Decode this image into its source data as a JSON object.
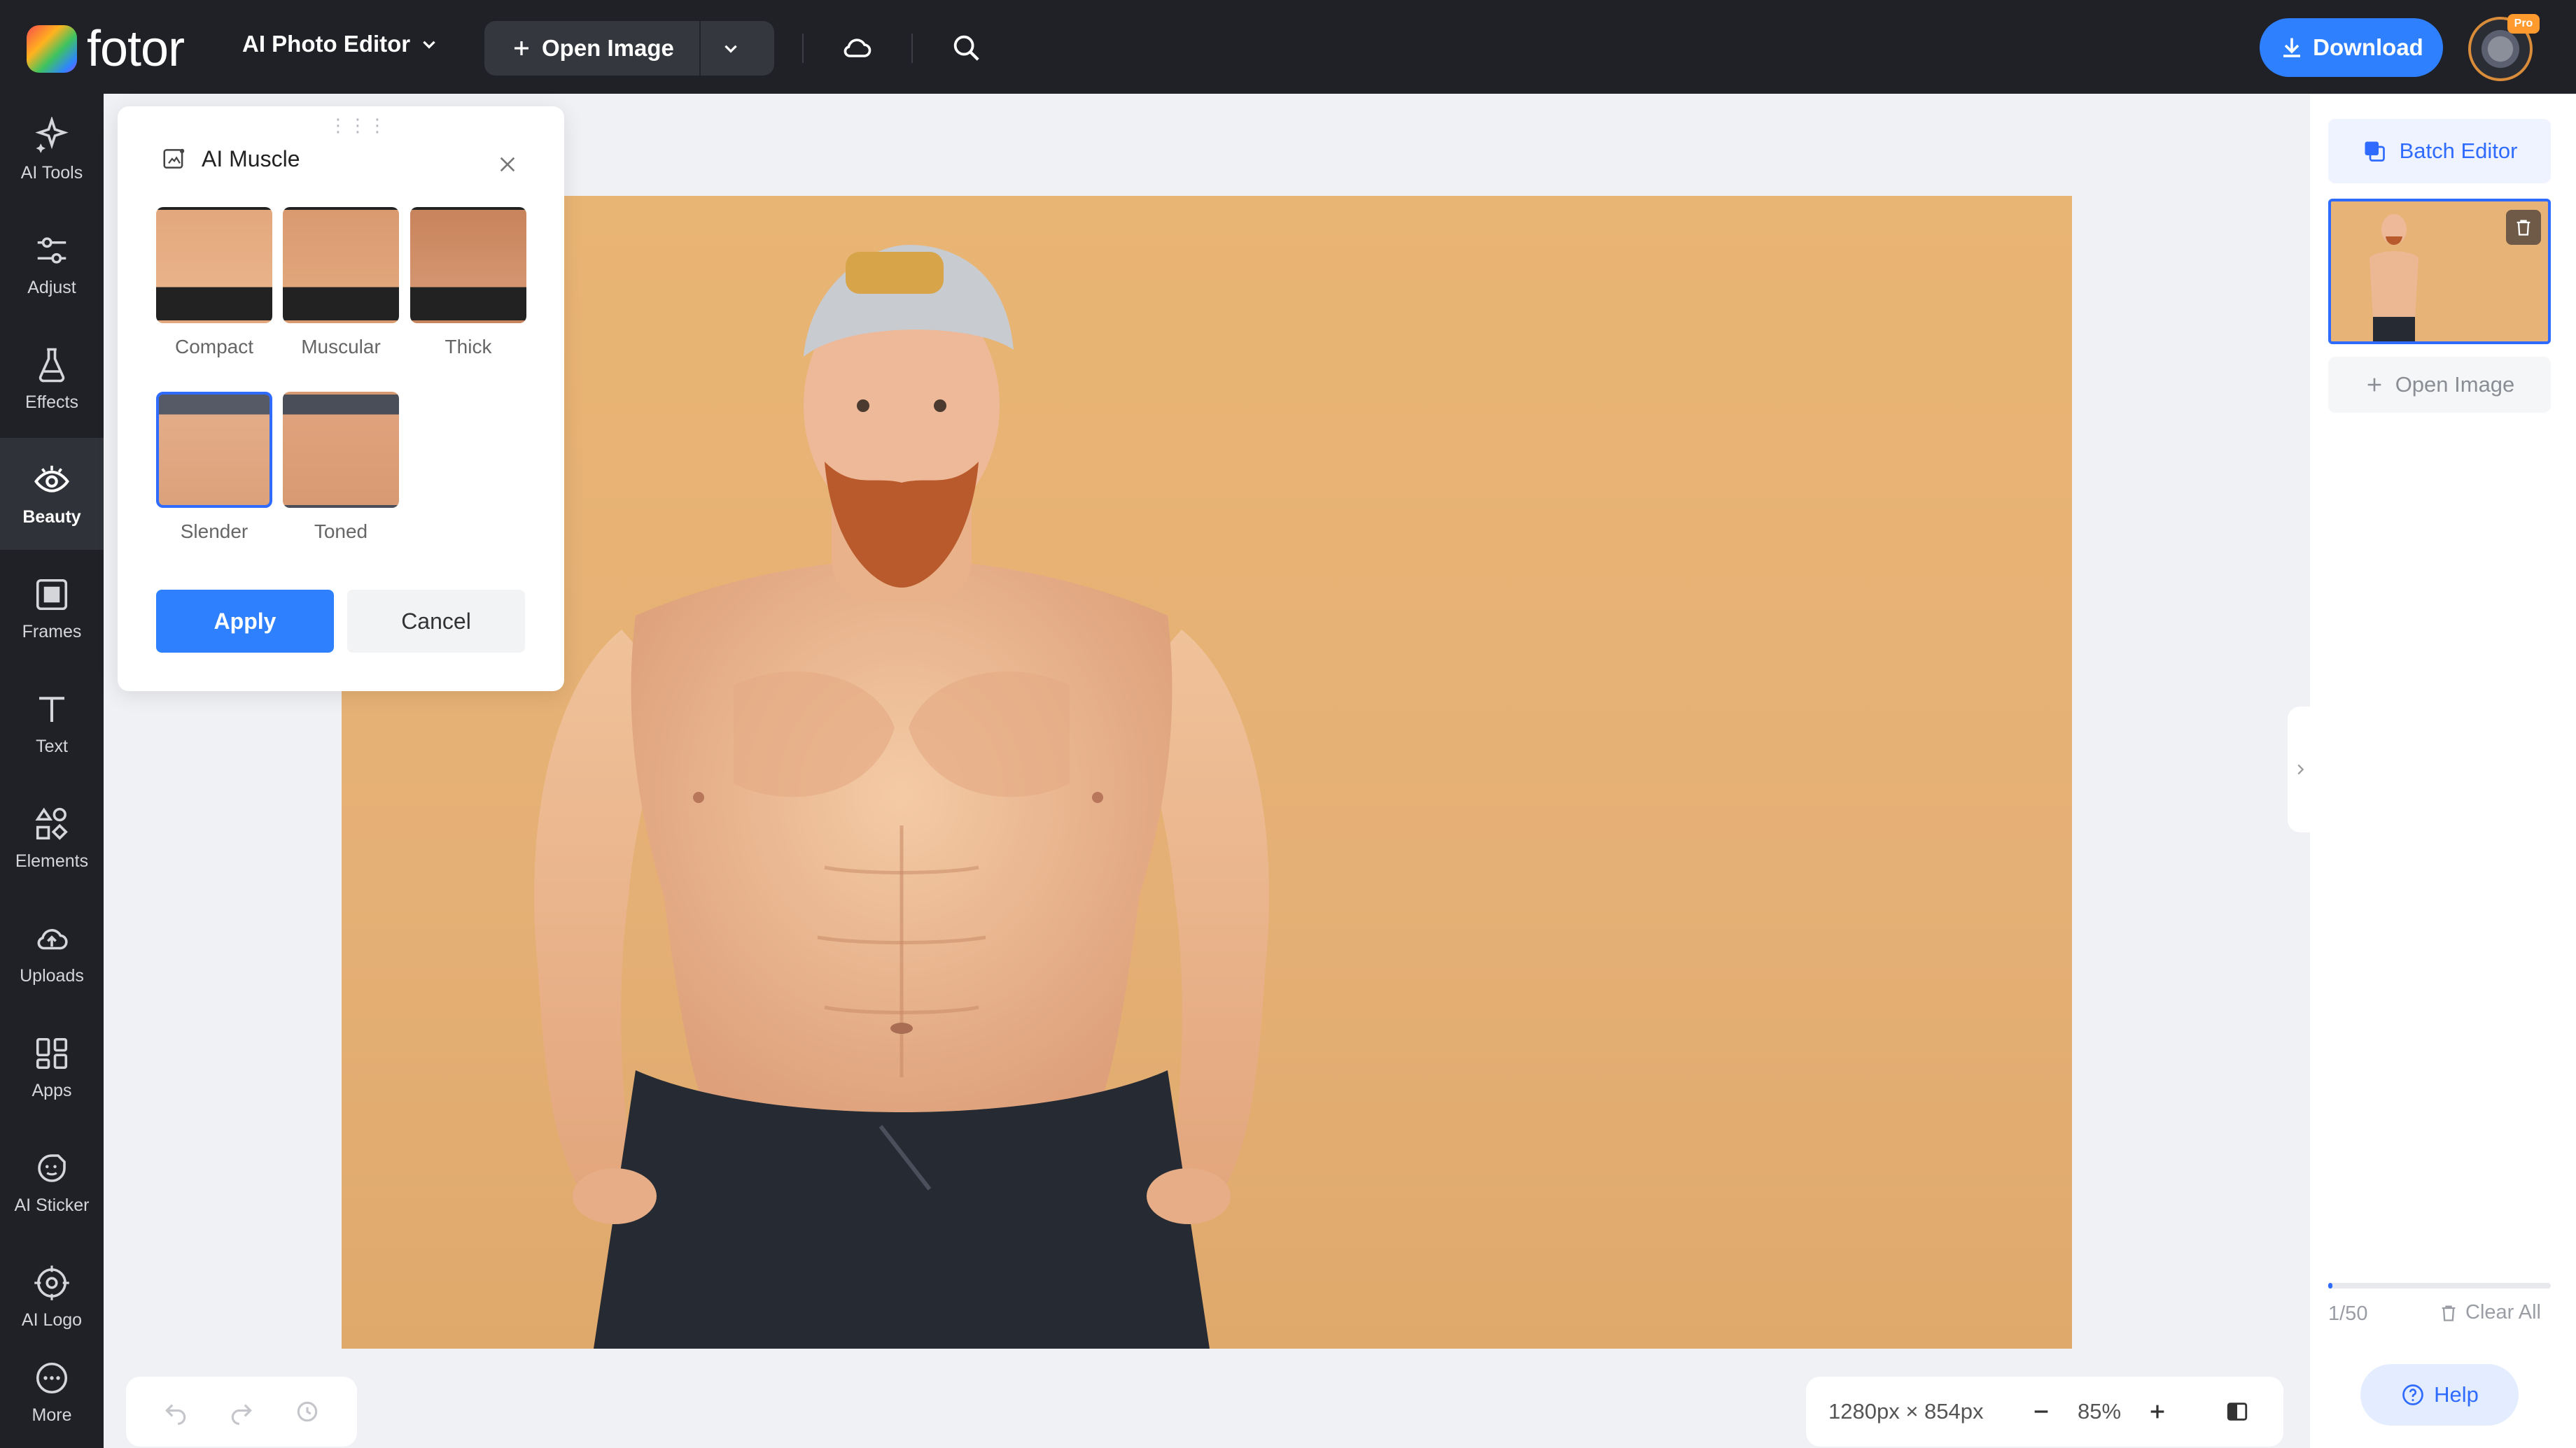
{
  "header": {
    "logo_text": "fotor",
    "app_menu_label": "AI Photo Editor",
    "open_image_label": "Open Image",
    "download_label": "Download",
    "pro_badge": "Pro"
  },
  "sidebar": {
    "items": [
      {
        "label": "AI Tools",
        "icon": "sparkle-icon"
      },
      {
        "label": "Adjust",
        "icon": "sliders-icon"
      },
      {
        "label": "Effects",
        "icon": "flask-icon"
      },
      {
        "label": "Beauty",
        "icon": "eye-icon",
        "active": true
      },
      {
        "label": "Frames",
        "icon": "frame-icon"
      },
      {
        "label": "Text",
        "icon": "text-icon"
      },
      {
        "label": "Elements",
        "icon": "shapes-icon"
      },
      {
        "label": "Uploads",
        "icon": "cloud-upload-icon"
      },
      {
        "label": "Apps",
        "icon": "apps-icon"
      },
      {
        "label": "AI Sticker",
        "icon": "sticker-icon"
      },
      {
        "label": "AI Logo",
        "icon": "ai-logo-icon"
      },
      {
        "label": "More",
        "icon": "more-icon"
      }
    ]
  },
  "panel": {
    "title": "AI Muscle",
    "options": [
      {
        "label": "Compact"
      },
      {
        "label": "Muscular"
      },
      {
        "label": "Thick"
      },
      {
        "label": "Slender",
        "selected": true
      },
      {
        "label": "Toned"
      }
    ],
    "apply_label": "Apply",
    "cancel_label": "Cancel"
  },
  "right_panel": {
    "batch_label": "Batch Editor",
    "open_image_label": "Open Image",
    "count": "1/50",
    "progress_fraction": 0.02,
    "clear_label": "Clear All",
    "help_label": "Help"
  },
  "zoom": {
    "dimensions": "1280px × 854px",
    "percent": "85%"
  },
  "colors": {
    "accent": "#2f80ff",
    "topbar": "#1f2126",
    "canvas_bg": "#e6b274"
  }
}
